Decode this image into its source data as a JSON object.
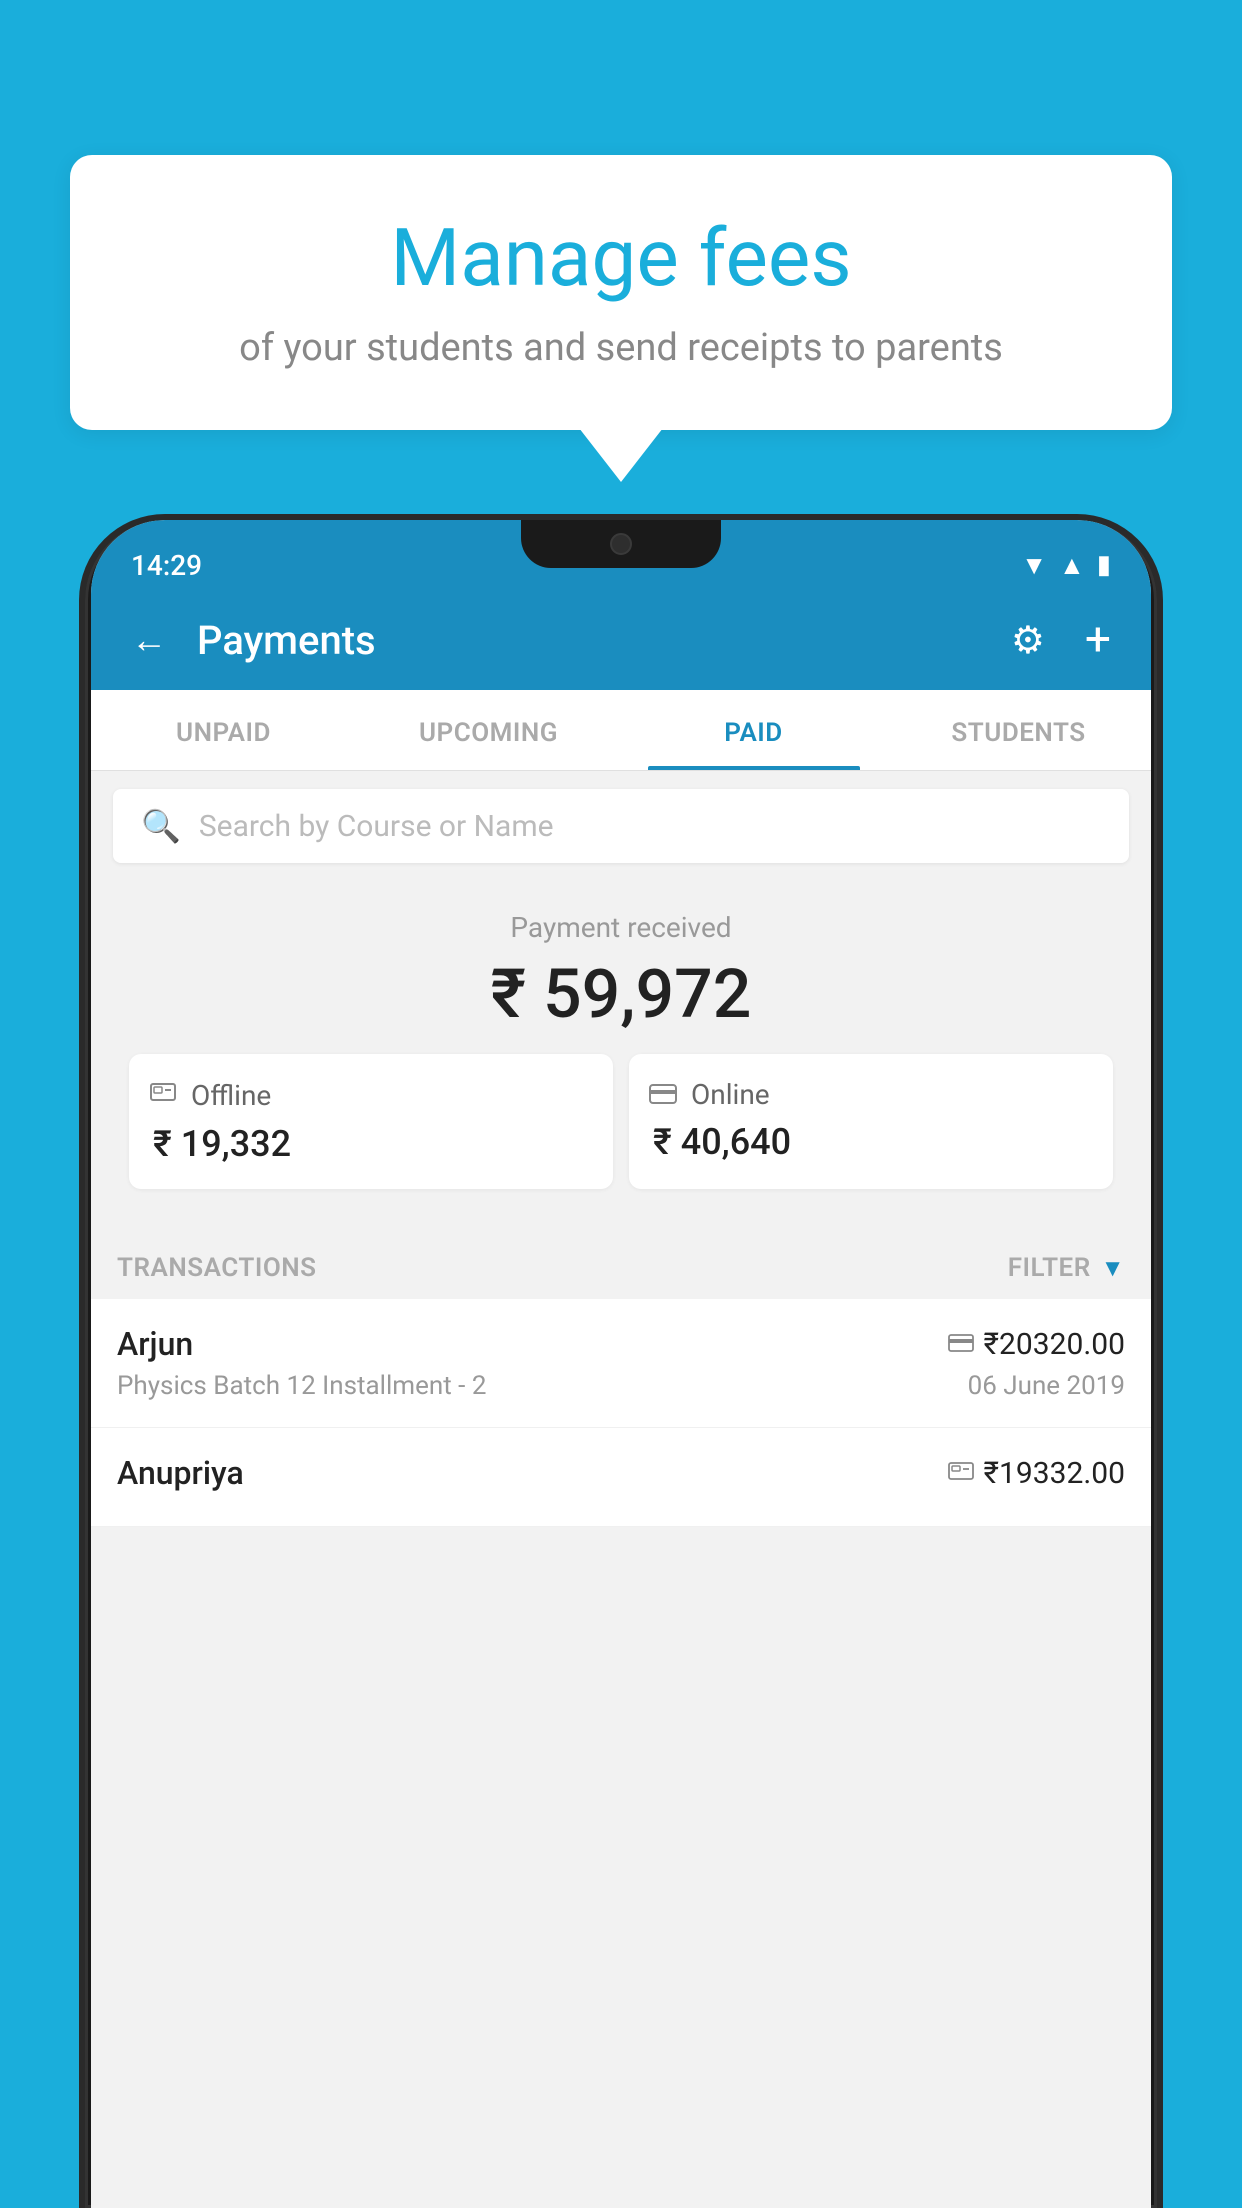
{
  "background_color": "#1AAEDB",
  "bubble": {
    "title": "Manage fees",
    "subtitle": "of your students and send receipts to parents"
  },
  "status_bar": {
    "time": "14:29",
    "wifi": "▼",
    "signal": "▲",
    "battery": "▮"
  },
  "header": {
    "title": "Payments",
    "back_label": "←",
    "gear_label": "⚙",
    "plus_label": "+"
  },
  "tabs": [
    {
      "label": "UNPAID",
      "active": false
    },
    {
      "label": "UPCOMING",
      "active": false
    },
    {
      "label": "PAID",
      "active": true
    },
    {
      "label": "STUDENTS",
      "active": false
    }
  ],
  "search": {
    "placeholder": "Search by Course or Name"
  },
  "payment_summary": {
    "label": "Payment received",
    "amount": "₹ 59,972",
    "offline": {
      "label": "Offline",
      "amount": "₹ 19,332"
    },
    "online": {
      "label": "Online",
      "amount": "₹ 40,640"
    }
  },
  "transactions": {
    "label": "TRANSACTIONS",
    "filter_label": "FILTER",
    "items": [
      {
        "name": "Arjun",
        "payment_type": "online",
        "amount": "₹20320.00",
        "course": "Physics Batch 12 Installment - 2",
        "date": "06 June 2019"
      },
      {
        "name": "Anupriya",
        "payment_type": "offline",
        "amount": "₹19332.00",
        "course": "",
        "date": ""
      }
    ]
  }
}
